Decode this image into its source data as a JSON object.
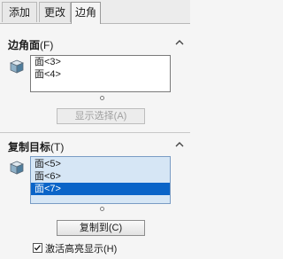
{
  "tabs": [
    {
      "label": "添加"
    },
    {
      "label": "更改"
    },
    {
      "label": "边角"
    }
  ],
  "edge_face_section": {
    "title": "边角面",
    "hotkey": "(F)",
    "items": [
      "面<3>",
      "面<4>"
    ],
    "show_selection_button": "显示选择(A)"
  },
  "copy_target_section": {
    "title": "复制目标",
    "hotkey": "(T)",
    "items": [
      "面<5>",
      "面<6>",
      "面<7>"
    ],
    "selected_index": 2,
    "copy_to_button": "复制到(C)",
    "activate_highlight_label": "激活高亮显示(H)",
    "activate_highlight_checked": true
  },
  "colors": {
    "selection": "#0a64c8",
    "list_blue": "#d6e6f5"
  },
  "icons": {
    "face_icon": "cube-icon",
    "collapse_icon": "chevron-up-icon"
  }
}
